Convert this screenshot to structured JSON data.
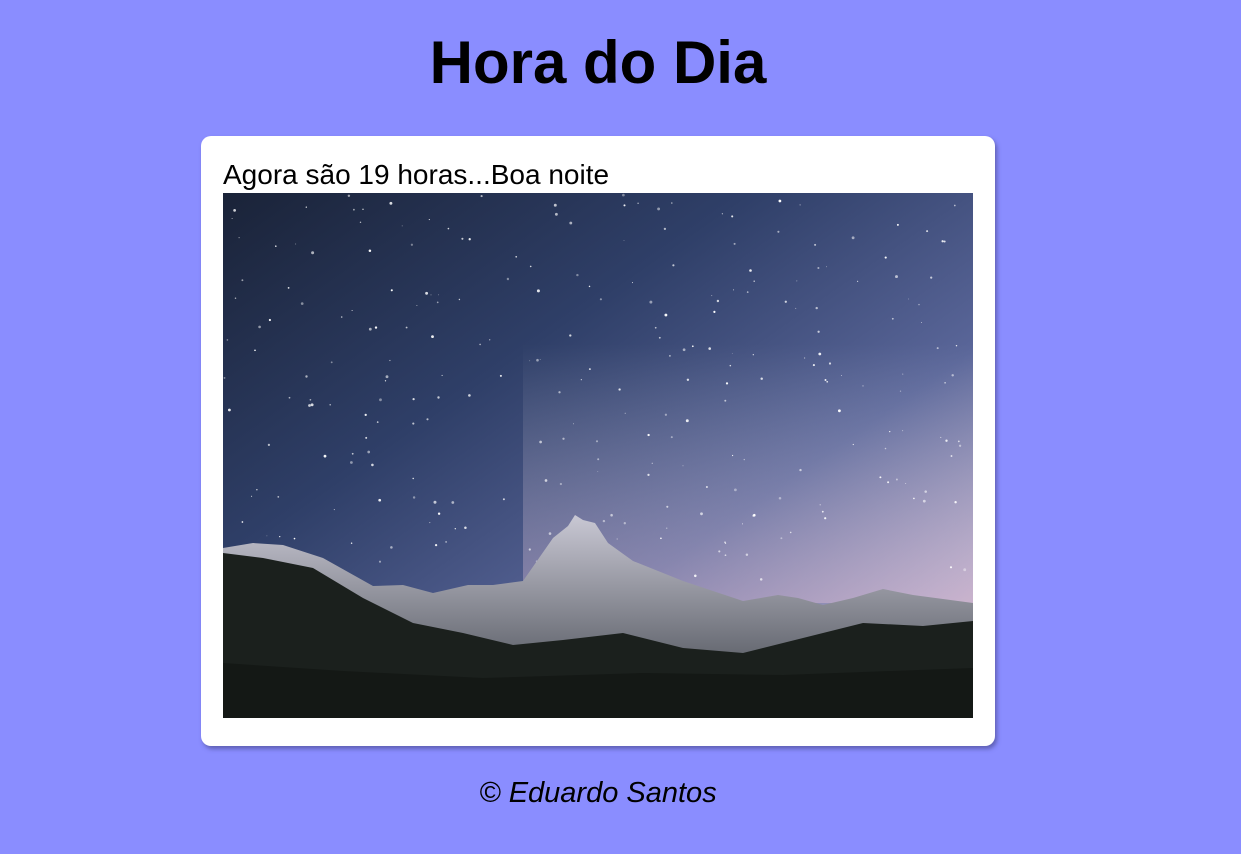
{
  "page": {
    "title": "Hora do Dia",
    "background_color": "#8a8dff"
  },
  "main": {
    "message": "Agora são 19 horas...Boa noite",
    "image": {
      "icon": "night-sky-mountain-image",
      "sky_colors": [
        "#1d2a44",
        "#3b4f7f",
        "#7f86b8",
        "#d3b6c8"
      ],
      "mountain_color": "#151a17"
    }
  },
  "footer": {
    "text": "© Eduardo Santos"
  }
}
